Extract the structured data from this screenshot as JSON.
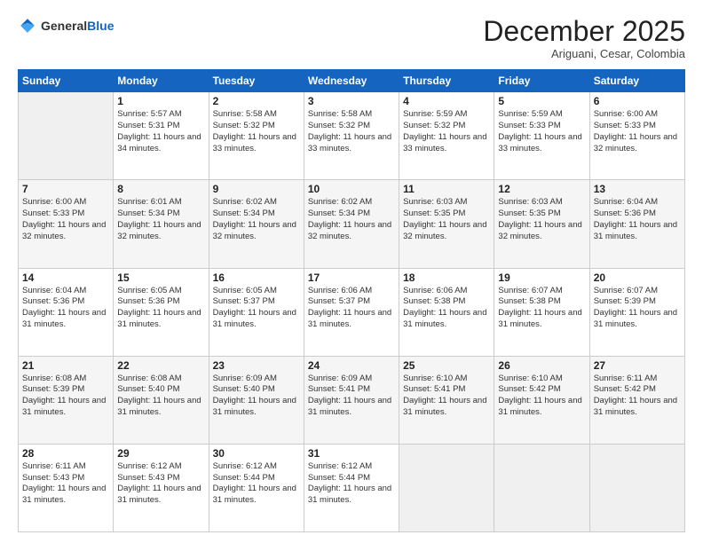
{
  "logo": {
    "general": "General",
    "blue": "Blue"
  },
  "header": {
    "month": "December 2025",
    "location": "Ariguani, Cesar, Colombia"
  },
  "weekdays": [
    "Sunday",
    "Monday",
    "Tuesday",
    "Wednesday",
    "Thursday",
    "Friday",
    "Saturday"
  ],
  "weeks": [
    [
      {
        "day": "",
        "sunrise": "",
        "sunset": "",
        "daylight": ""
      },
      {
        "day": "1",
        "sunrise": "Sunrise: 5:57 AM",
        "sunset": "Sunset: 5:31 PM",
        "daylight": "Daylight: 11 hours and 34 minutes."
      },
      {
        "day": "2",
        "sunrise": "Sunrise: 5:58 AM",
        "sunset": "Sunset: 5:32 PM",
        "daylight": "Daylight: 11 hours and 33 minutes."
      },
      {
        "day": "3",
        "sunrise": "Sunrise: 5:58 AM",
        "sunset": "Sunset: 5:32 PM",
        "daylight": "Daylight: 11 hours and 33 minutes."
      },
      {
        "day": "4",
        "sunrise": "Sunrise: 5:59 AM",
        "sunset": "Sunset: 5:32 PM",
        "daylight": "Daylight: 11 hours and 33 minutes."
      },
      {
        "day": "5",
        "sunrise": "Sunrise: 5:59 AM",
        "sunset": "Sunset: 5:33 PM",
        "daylight": "Daylight: 11 hours and 33 minutes."
      },
      {
        "day": "6",
        "sunrise": "Sunrise: 6:00 AM",
        "sunset": "Sunset: 5:33 PM",
        "daylight": "Daylight: 11 hours and 32 minutes."
      }
    ],
    [
      {
        "day": "7",
        "sunrise": "Sunrise: 6:00 AM",
        "sunset": "Sunset: 5:33 PM",
        "daylight": "Daylight: 11 hours and 32 minutes."
      },
      {
        "day": "8",
        "sunrise": "Sunrise: 6:01 AM",
        "sunset": "Sunset: 5:34 PM",
        "daylight": "Daylight: 11 hours and 32 minutes."
      },
      {
        "day": "9",
        "sunrise": "Sunrise: 6:02 AM",
        "sunset": "Sunset: 5:34 PM",
        "daylight": "Daylight: 11 hours and 32 minutes."
      },
      {
        "day": "10",
        "sunrise": "Sunrise: 6:02 AM",
        "sunset": "Sunset: 5:34 PM",
        "daylight": "Daylight: 11 hours and 32 minutes."
      },
      {
        "day": "11",
        "sunrise": "Sunrise: 6:03 AM",
        "sunset": "Sunset: 5:35 PM",
        "daylight": "Daylight: 11 hours and 32 minutes."
      },
      {
        "day": "12",
        "sunrise": "Sunrise: 6:03 AM",
        "sunset": "Sunset: 5:35 PM",
        "daylight": "Daylight: 11 hours and 32 minutes."
      },
      {
        "day": "13",
        "sunrise": "Sunrise: 6:04 AM",
        "sunset": "Sunset: 5:36 PM",
        "daylight": "Daylight: 11 hours and 31 minutes."
      }
    ],
    [
      {
        "day": "14",
        "sunrise": "Sunrise: 6:04 AM",
        "sunset": "Sunset: 5:36 PM",
        "daylight": "Daylight: 11 hours and 31 minutes."
      },
      {
        "day": "15",
        "sunrise": "Sunrise: 6:05 AM",
        "sunset": "Sunset: 5:36 PM",
        "daylight": "Daylight: 11 hours and 31 minutes."
      },
      {
        "day": "16",
        "sunrise": "Sunrise: 6:05 AM",
        "sunset": "Sunset: 5:37 PM",
        "daylight": "Daylight: 11 hours and 31 minutes."
      },
      {
        "day": "17",
        "sunrise": "Sunrise: 6:06 AM",
        "sunset": "Sunset: 5:37 PM",
        "daylight": "Daylight: 11 hours and 31 minutes."
      },
      {
        "day": "18",
        "sunrise": "Sunrise: 6:06 AM",
        "sunset": "Sunset: 5:38 PM",
        "daylight": "Daylight: 11 hours and 31 minutes."
      },
      {
        "day": "19",
        "sunrise": "Sunrise: 6:07 AM",
        "sunset": "Sunset: 5:38 PM",
        "daylight": "Daylight: 11 hours and 31 minutes."
      },
      {
        "day": "20",
        "sunrise": "Sunrise: 6:07 AM",
        "sunset": "Sunset: 5:39 PM",
        "daylight": "Daylight: 11 hours and 31 minutes."
      }
    ],
    [
      {
        "day": "21",
        "sunrise": "Sunrise: 6:08 AM",
        "sunset": "Sunset: 5:39 PM",
        "daylight": "Daylight: 11 hours and 31 minutes."
      },
      {
        "day": "22",
        "sunrise": "Sunrise: 6:08 AM",
        "sunset": "Sunset: 5:40 PM",
        "daylight": "Daylight: 11 hours and 31 minutes."
      },
      {
        "day": "23",
        "sunrise": "Sunrise: 6:09 AM",
        "sunset": "Sunset: 5:40 PM",
        "daylight": "Daylight: 11 hours and 31 minutes."
      },
      {
        "day": "24",
        "sunrise": "Sunrise: 6:09 AM",
        "sunset": "Sunset: 5:41 PM",
        "daylight": "Daylight: 11 hours and 31 minutes."
      },
      {
        "day": "25",
        "sunrise": "Sunrise: 6:10 AM",
        "sunset": "Sunset: 5:41 PM",
        "daylight": "Daylight: 11 hours and 31 minutes."
      },
      {
        "day": "26",
        "sunrise": "Sunrise: 6:10 AM",
        "sunset": "Sunset: 5:42 PM",
        "daylight": "Daylight: 11 hours and 31 minutes."
      },
      {
        "day": "27",
        "sunrise": "Sunrise: 6:11 AM",
        "sunset": "Sunset: 5:42 PM",
        "daylight": "Daylight: 11 hours and 31 minutes."
      }
    ],
    [
      {
        "day": "28",
        "sunrise": "Sunrise: 6:11 AM",
        "sunset": "Sunset: 5:43 PM",
        "daylight": "Daylight: 11 hours and 31 minutes."
      },
      {
        "day": "29",
        "sunrise": "Sunrise: 6:12 AM",
        "sunset": "Sunset: 5:43 PM",
        "daylight": "Daylight: 11 hours and 31 minutes."
      },
      {
        "day": "30",
        "sunrise": "Sunrise: 6:12 AM",
        "sunset": "Sunset: 5:44 PM",
        "daylight": "Daylight: 11 hours and 31 minutes."
      },
      {
        "day": "31",
        "sunrise": "Sunrise: 6:12 AM",
        "sunset": "Sunset: 5:44 PM",
        "daylight": "Daylight: 11 hours and 31 minutes."
      },
      {
        "day": "",
        "sunrise": "",
        "sunset": "",
        "daylight": ""
      },
      {
        "day": "",
        "sunrise": "",
        "sunset": "",
        "daylight": ""
      },
      {
        "day": "",
        "sunrise": "",
        "sunset": "",
        "daylight": ""
      }
    ]
  ]
}
